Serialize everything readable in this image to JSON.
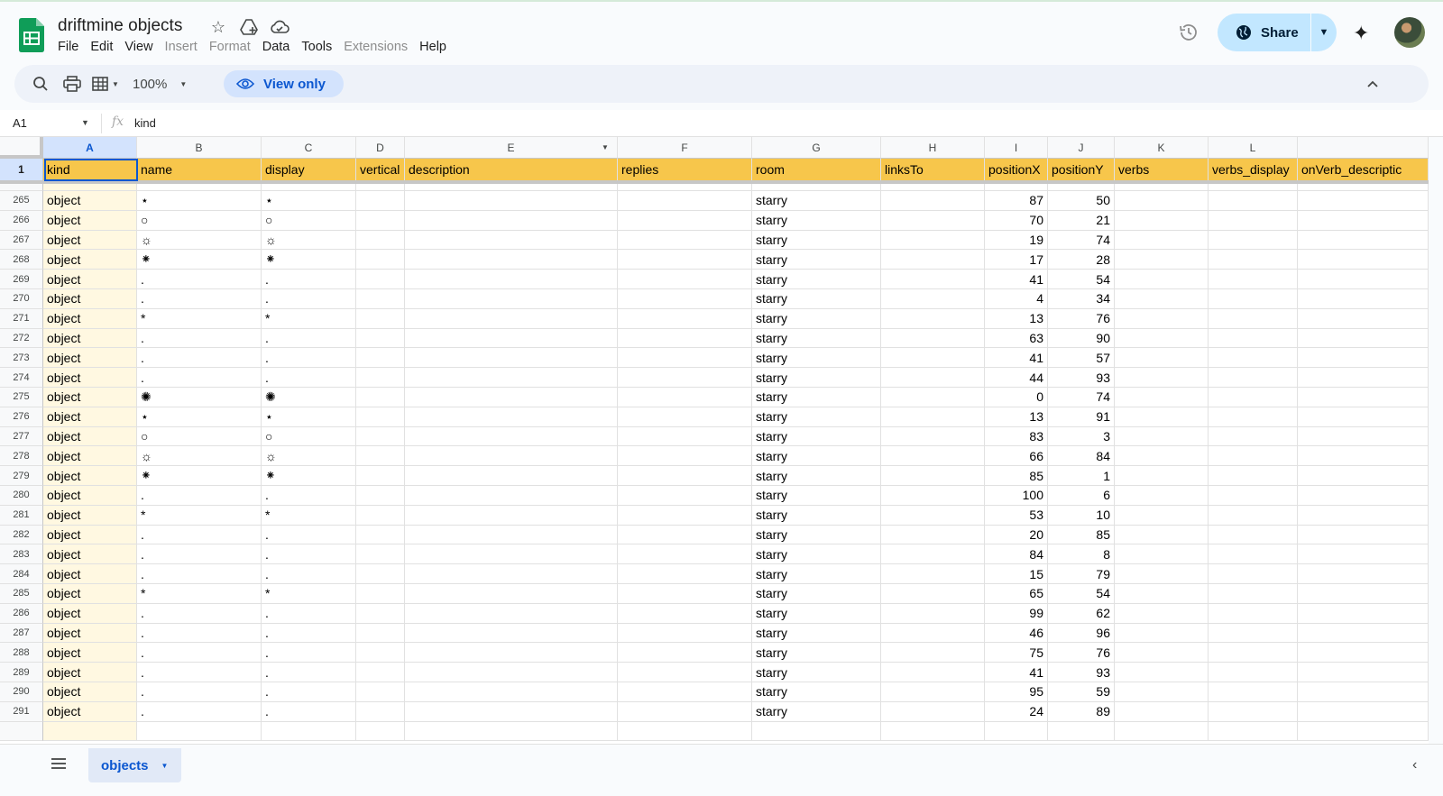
{
  "doc": {
    "title": "driftmine objects"
  },
  "menu": [
    {
      "label": "File",
      "enabled": true
    },
    {
      "label": "Edit",
      "enabled": true
    },
    {
      "label": "View",
      "enabled": true
    },
    {
      "label": "Insert",
      "enabled": false
    },
    {
      "label": "Format",
      "enabled": false
    },
    {
      "label": "Data",
      "enabled": true
    },
    {
      "label": "Tools",
      "enabled": true
    },
    {
      "label": "Extensions",
      "enabled": false
    },
    {
      "label": "Help",
      "enabled": true
    }
  ],
  "share": {
    "label": "Share"
  },
  "toolbar": {
    "zoom": "100%",
    "view_only_label": "View only"
  },
  "formula": {
    "cell_ref": "A1",
    "value": "kind"
  },
  "columns": [
    {
      "letter": "A",
      "header": "kind"
    },
    {
      "letter": "B",
      "header": "name"
    },
    {
      "letter": "C",
      "header": "display"
    },
    {
      "letter": "D",
      "header": "vertical"
    },
    {
      "letter": "E",
      "header": "description"
    },
    {
      "letter": "F",
      "header": "replies"
    },
    {
      "letter": "G",
      "header": "room"
    },
    {
      "letter": "H",
      "header": "linksTo"
    },
    {
      "letter": "I",
      "header": "positionX"
    },
    {
      "letter": "J",
      "header": "positionY"
    },
    {
      "letter": "K",
      "header": "verbs"
    },
    {
      "letter": "L",
      "header": "verbs_display"
    },
    {
      "letter": "",
      "header": "onVerb_descriptic"
    }
  ],
  "header_row_num": "1",
  "rows": [
    {
      "n": "265",
      "kind": "object",
      "name": "⋆",
      "room": "starry",
      "x": "87",
      "y": "50"
    },
    {
      "n": "266",
      "kind": "object",
      "name": "○",
      "room": "starry",
      "x": "70",
      "y": "21"
    },
    {
      "n": "267",
      "kind": "object",
      "name": "☼",
      "room": "starry",
      "x": "19",
      "y": "74"
    },
    {
      "n": "268",
      "kind": "object",
      "name": "⁕",
      "room": "starry",
      "x": "17",
      "y": "28"
    },
    {
      "n": "269",
      "kind": "object",
      "name": ".",
      "room": "starry",
      "x": "41",
      "y": "54"
    },
    {
      "n": "270",
      "kind": "object",
      "name": ".",
      "room": "starry",
      "x": "4",
      "y": "34"
    },
    {
      "n": "271",
      "kind": "object",
      "name": "*",
      "room": "starry",
      "x": "13",
      "y": "76"
    },
    {
      "n": "272",
      "kind": "object",
      "name": ".",
      "room": "starry",
      "x": "63",
      "y": "90"
    },
    {
      "n": "273",
      "kind": "object",
      "name": ".",
      "room": "starry",
      "x": "41",
      "y": "57"
    },
    {
      "n": "274",
      "kind": "object",
      "name": ".",
      "room": "starry",
      "x": "44",
      "y": "93"
    },
    {
      "n": "275",
      "kind": "object",
      "name": "✺",
      "room": "starry",
      "x": "0",
      "y": "74"
    },
    {
      "n": "276",
      "kind": "object",
      "name": "⋆",
      "room": "starry",
      "x": "13",
      "y": "91"
    },
    {
      "n": "277",
      "kind": "object",
      "name": "○",
      "room": "starry",
      "x": "83",
      "y": "3"
    },
    {
      "n": "278",
      "kind": "object",
      "name": "☼",
      "room": "starry",
      "x": "66",
      "y": "84"
    },
    {
      "n": "279",
      "kind": "object",
      "name": "⁕",
      "room": "starry",
      "x": "85",
      "y": "1"
    },
    {
      "n": "280",
      "kind": "object",
      "name": ".",
      "room": "starry",
      "x": "100",
      "y": "6"
    },
    {
      "n": "281",
      "kind": "object",
      "name": "*",
      "room": "starry",
      "x": "53",
      "y": "10"
    },
    {
      "n": "282",
      "kind": "object",
      "name": ".",
      "room": "starry",
      "x": "20",
      "y": "85"
    },
    {
      "n": "283",
      "kind": "object",
      "name": ".",
      "room": "starry",
      "x": "84",
      "y": "8"
    },
    {
      "n": "284",
      "kind": "object",
      "name": ".",
      "room": "starry",
      "x": "15",
      "y": "79"
    },
    {
      "n": "285",
      "kind": "object",
      "name": "*",
      "room": "starry",
      "x": "65",
      "y": "54"
    },
    {
      "n": "286",
      "kind": "object",
      "name": ".",
      "room": "starry",
      "x": "99",
      "y": "62"
    },
    {
      "n": "287",
      "kind": "object",
      "name": ".",
      "room": "starry",
      "x": "46",
      "y": "96"
    },
    {
      "n": "288",
      "kind": "object",
      "name": ".",
      "room": "starry",
      "x": "75",
      "y": "76"
    },
    {
      "n": "289",
      "kind": "object",
      "name": ".",
      "room": "starry",
      "x": "41",
      "y": "93"
    },
    {
      "n": "290",
      "kind": "object",
      "name": ".",
      "room": "starry",
      "x": "95",
      "y": "59"
    },
    {
      "n": "291",
      "kind": "object",
      "name": ".",
      "room": "starry",
      "x": "24",
      "y": "89"
    }
  ],
  "sheet_tab": {
    "label": "objects"
  },
  "colors": {
    "header_fill": "#f7c64b",
    "col_a_fill": "#fff8e1",
    "accent": "#0b57d0",
    "share_bg": "#c2e7ff"
  }
}
